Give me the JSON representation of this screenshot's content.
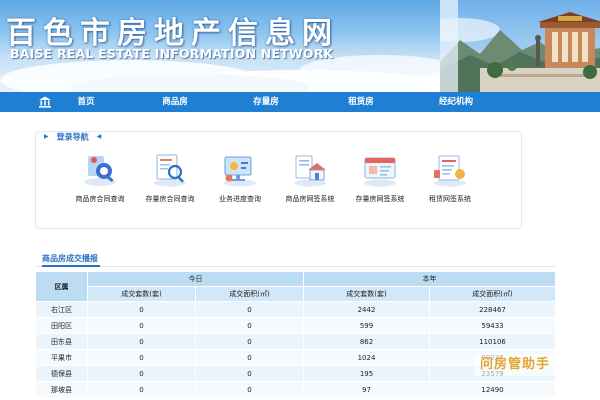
{
  "banner": {
    "title": "百色市房地产信息网",
    "subtitle": "BAISE REAL ESTATE INFORMATION NETWORK",
    "slide_count": 2,
    "active_slide": 2
  },
  "nav": {
    "home_icon": "bank-building-icon",
    "items": [
      {
        "label": "首页"
      },
      {
        "label": "商品房"
      },
      {
        "label": "存量房"
      },
      {
        "label": "租赁房"
      },
      {
        "label": "经纪机构"
      }
    ]
  },
  "guide": {
    "title": "登录导航",
    "items": [
      {
        "label": "商品房合同查询",
        "icon": "contract-query-icon"
      },
      {
        "label": "存量房合同查询",
        "icon": "document-search-icon"
      },
      {
        "label": "业务进度查询",
        "icon": "progress-search-icon"
      },
      {
        "label": "商品房网签系统",
        "icon": "new-house-sign-icon"
      },
      {
        "label": "存量房网签系统",
        "icon": "existing-house-sign-icon"
      },
      {
        "label": "租赁网签系统",
        "icon": "rental-sign-icon"
      }
    ]
  },
  "stats": {
    "tab_label": "商品房成交播报",
    "headers": {
      "district": "区属",
      "today": "今日",
      "year": "本年",
      "count": "成交套数(套)",
      "area": "成交面积(㎡)"
    },
    "rows": [
      {
        "district": "右江区",
        "today_count": "0",
        "today_area": "0",
        "year_count": "2442",
        "year_area": "228467"
      },
      {
        "district": "田阳区",
        "today_count": "0",
        "today_area": "0",
        "year_count": "599",
        "year_area": "59433"
      },
      {
        "district": "田东县",
        "today_count": "0",
        "today_area": "0",
        "year_count": "862",
        "year_area": "110106"
      },
      {
        "district": "平果市",
        "today_count": "0",
        "today_area": "0",
        "year_count": "1024",
        "year_area": "99237"
      },
      {
        "district": "德保县",
        "today_count": "0",
        "today_area": "0",
        "year_count": "195",
        "year_area": "23579"
      },
      {
        "district": "那坡县",
        "today_count": "0",
        "today_area": "0",
        "year_count": "97",
        "year_area": "12490"
      }
    ]
  },
  "watermark": "问房管助手",
  "colors": {
    "nav_bg": "#1e7fd3",
    "accent": "#2a73c4",
    "table_header": "#bcdcf3",
    "watermark": "#e4a630"
  }
}
